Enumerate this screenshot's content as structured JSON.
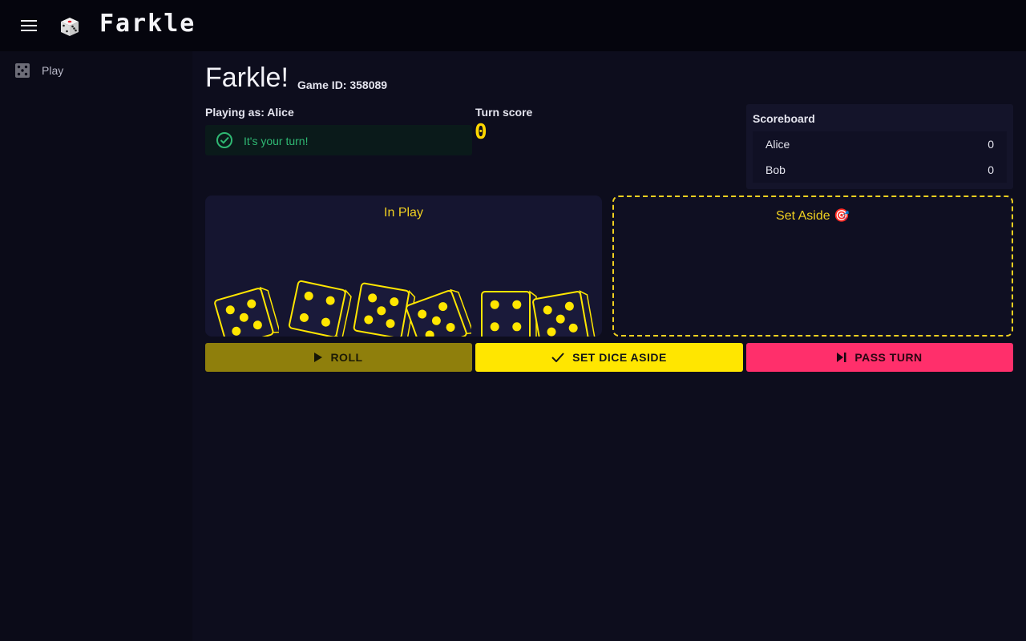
{
  "app": {
    "brand": "Farkle",
    "logo_icon": "die-emoji-icon",
    "menu_icon": "hamburger-menu-icon"
  },
  "sidebar": {
    "items": [
      {
        "label": "Play",
        "icon": "dice-five-icon"
      }
    ]
  },
  "main": {
    "title": "Farkle!",
    "game_id": "Game ID: 358089",
    "playing_as_prefix": "Playing as: ",
    "player_name": "Alice",
    "status_message": "It's your turn!",
    "turn_score_label": "Turn score",
    "turn_score_value": "0"
  },
  "scoreboard": {
    "title": "Scoreboard",
    "rows": [
      {
        "name": "Alice",
        "score": "0"
      },
      {
        "name": "Bob",
        "score": "0"
      }
    ]
  },
  "zones": {
    "in_play_title": "In Play",
    "set_aside_title": "Set Aside 🎯",
    "in_play_dice": [
      5,
      4,
      5,
      5,
      4,
      5
    ]
  },
  "buttons": {
    "roll": "ROLL",
    "set_aside": "SET DICE ASIDE",
    "pass": "PASS TURN"
  },
  "colors": {
    "accent": "#ffe600",
    "roll_bg": "#8f7f0c",
    "pass_bg": "#ff2f6b",
    "success": "#2fb873",
    "die_face": "#1a1a3a",
    "pip": "#ffe600"
  }
}
